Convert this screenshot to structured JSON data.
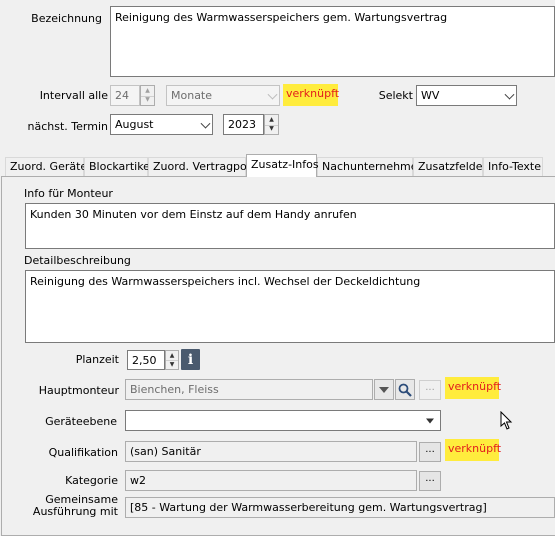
{
  "bezeichnung": {
    "label": "Bezeichnung",
    "value": "Reinigung des Warmwasserspeichers gem. Wartungsvertrag"
  },
  "intervall": {
    "label": "Intervall alle",
    "value": "24",
    "unit": "Monate",
    "badge": "verknüpft"
  },
  "selekt": {
    "label": "Selekt",
    "value": "WV"
  },
  "naechster_termin": {
    "label": "nächst. Termin",
    "month": "August",
    "year": "2023"
  },
  "tabs": [
    {
      "label": "Zuord. Geräte"
    },
    {
      "label": "Blockartikel"
    },
    {
      "label": "Zuord. Vertragpos"
    },
    {
      "label": "Zusatz-Infos",
      "active": true
    },
    {
      "label": "Nachunternehmer"
    },
    {
      "label": "Zusatzfelder"
    },
    {
      "label": "Info-Texte"
    }
  ],
  "info_monteur": {
    "label": "Info für Monteur",
    "value": "Kunden 30 Minuten vor dem Einstz auf dem Handy anrufen"
  },
  "detailbeschreibung": {
    "label": "Detailbeschreibung",
    "value": "Reinigung des Warmwasserspeichers incl. Wechsel der Deckeldichtung"
  },
  "planzeit": {
    "label": "Planzeit",
    "value": "2,50"
  },
  "hauptmonteur": {
    "label": "Hauptmonteur",
    "value": "Bienchen, Fleiss",
    "ellipsis": "...",
    "badge": "verknüpft"
  },
  "geraeteebene": {
    "label": "Geräteebene",
    "value": ""
  },
  "qualifikation": {
    "label": "Qualifikation",
    "value": "(san) Sanitär",
    "ellipsis": "...",
    "badge": "verknüpft"
  },
  "kategorie": {
    "label": "Kategorie",
    "value": "w2",
    "ellipsis": "..."
  },
  "gemeinsame": {
    "label_line1": "Gemeinsame",
    "label_line2": "Ausführung mit",
    "value": "[85 - Wartung der Warmwasserbereitung gem. Wartungsvertrag]"
  },
  "colors": {
    "badge_bg": "#ffec3d",
    "badge_text": "#e21d1d",
    "window_bg": "#f0f0f0",
    "field_border": "#7a7a7a"
  },
  "icons": [
    "chevron-down-icon",
    "spin-up-icon",
    "spin-down-icon",
    "info-icon",
    "search-icon",
    "dropdown-triangle-icon",
    "mouse-cursor-icon"
  ]
}
